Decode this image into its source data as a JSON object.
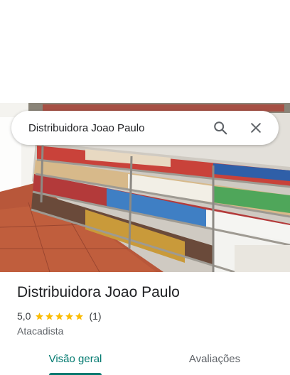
{
  "search": {
    "query": "Distribuidora Joao Paulo",
    "search_icon": "search-icon",
    "close_icon": "close-icon"
  },
  "place": {
    "name": "Distribuidora Joao Paulo",
    "rating": "5,0",
    "stars": 5,
    "review_count": "(1)",
    "category": "Atacadista"
  },
  "tabs": [
    {
      "label": "Visão geral",
      "selected": true
    },
    {
      "label": "Avaliações",
      "selected": false
    }
  ],
  "colors": {
    "accent": "#01796f",
    "star": "#fbbc04",
    "text_primary": "#202124",
    "text_secondary": "#5f6368"
  }
}
